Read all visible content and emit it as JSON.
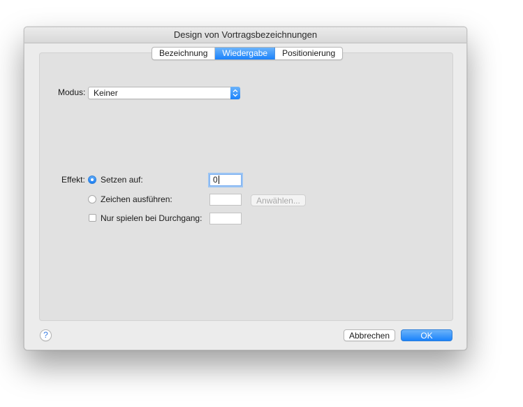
{
  "window": {
    "title": "Design von Vortragsbezeichnungen"
  },
  "tabs": [
    {
      "label": "Bezeichnung",
      "active": false
    },
    {
      "label": "Wiedergabe",
      "active": true
    },
    {
      "label": "Positionierung",
      "active": false
    }
  ],
  "modus": {
    "label": "Modus:",
    "selected": "Keiner"
  },
  "effekt": {
    "label": "Effekt:",
    "setzen_auf": {
      "label": "Setzen auf:",
      "checked": true,
      "value": "0"
    },
    "zeichen_ausfuehren": {
      "label": "Zeichen ausführen:",
      "checked": false,
      "value": "",
      "button_label": "Anwählen..."
    },
    "nur_spielen": {
      "label": "Nur spielen bei Durchgang:",
      "checked": false,
      "value": ""
    }
  },
  "footer": {
    "help_label": "?",
    "cancel_label": "Abbrechen",
    "ok_label": "OK"
  },
  "colors": {
    "accent": "#1a82fb",
    "window_bg": "#ececec",
    "panel_bg": "#e1e1e1"
  }
}
